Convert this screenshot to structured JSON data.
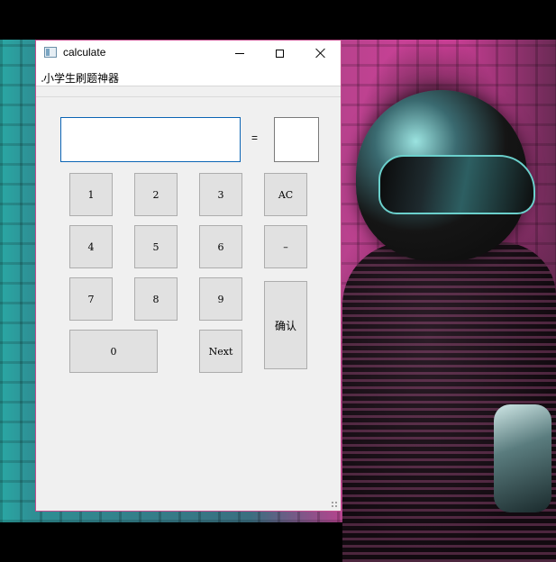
{
  "window": {
    "title": "calculate",
    "icon": "app-window-icon",
    "controls": {
      "minimize": "minimize-icon",
      "maximize": "maximize-icon",
      "close": "close-icon"
    }
  },
  "menu": {
    "items": [
      "小学生刷题神器"
    ]
  },
  "display": {
    "expression": "",
    "equals": "=",
    "answer": ""
  },
  "keys": {
    "k1": "1",
    "k2": "2",
    "k3": "3",
    "ac": "AC",
    "k4": "4",
    "k5": "5",
    "k6": "6",
    "minus": "–",
    "k7": "7",
    "k8": "8",
    "k9": "9",
    "confirm": "确认",
    "k0": "0",
    "next": "Next"
  },
  "colors": {
    "window_border": "#c34d8e",
    "input_focus_border": "#0a64b4",
    "button_face": "#e1e1e1"
  }
}
